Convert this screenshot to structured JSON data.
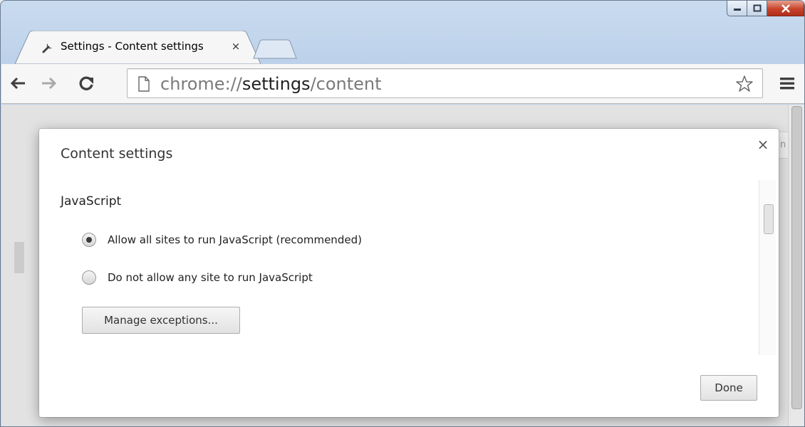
{
  "window": {
    "tab_title": "Settings - Content settings",
    "tab_close_glyph": "×",
    "caption_buttons": [
      "minimize-icon",
      "maximize-icon",
      "close-icon"
    ],
    "colors": {
      "close_button": "#c7432b"
    }
  },
  "toolbar": {
    "url_scheme": "chrome://",
    "url_host": "settings",
    "url_path": "/content",
    "icons": [
      "back-arrow-icon",
      "forward-arrow-icon",
      "reload-icon",
      "page-icon",
      "star-icon",
      "menu-icon"
    ]
  },
  "page": {
    "behind_peek_text": "n"
  },
  "dialog": {
    "title": "Content settings",
    "close_glyph": "×",
    "section_title": "JavaScript",
    "options": [
      {
        "label": "Allow all sites to run JavaScript (recommended)",
        "checked": true
      },
      {
        "label": "Do not allow any site to run JavaScript",
        "checked": false
      }
    ],
    "manage_button": "Manage exceptions...",
    "done_button": "Done"
  }
}
